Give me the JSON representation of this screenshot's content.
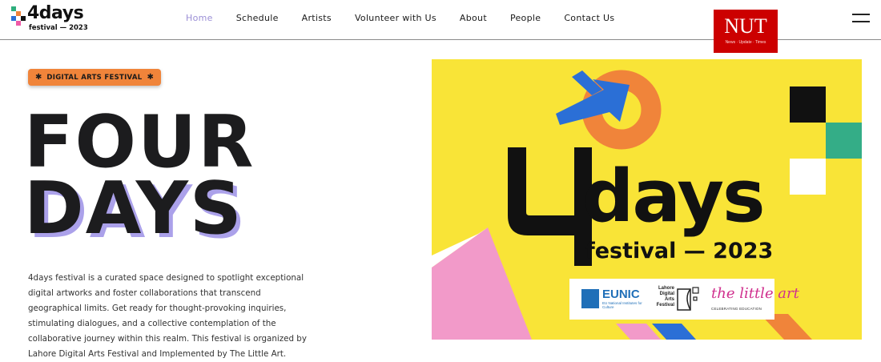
{
  "header": {
    "logo": {
      "word": "4days",
      "sub": "festival — 2023"
    },
    "nav": [
      {
        "label": "Home",
        "active": true
      },
      {
        "label": "Schedule",
        "active": false
      },
      {
        "label": "Artists",
        "active": false
      },
      {
        "label": "Volunteer with Us",
        "active": false
      },
      {
        "label": "About",
        "active": false
      },
      {
        "label": "People",
        "active": false
      },
      {
        "label": "Contact Us",
        "active": false
      }
    ],
    "menu_icon": "hamburger-menu-icon"
  },
  "nut_badge": {
    "title": "NUT",
    "sub": "News · Update · Times"
  },
  "hero": {
    "tag": "DIGITAL ARTS FESTIVAL",
    "tag_icon": "asterisk-icon",
    "line1": "FOUR",
    "line2": "DAYS",
    "description": "4days festival is a curated space designed to spotlight exceptional digital artworks and foster collaborations that transcend geographical limits. Get ready for thought-provoking inquiries, stimulating dialogues, and a collective contemplation of the collaborative journey within this realm. This festival is organized by Lahore Digital Arts Festival and Implemented by The Little Art."
  },
  "poster": {
    "word": "days",
    "sub": "festival — 2023",
    "partners": {
      "eunic": {
        "name": "EUNIC",
        "sub": "EU National Institutes for Culture"
      },
      "ldaf": {
        "text": "Lahore Digital Arts Festival"
      },
      "littleart": {
        "name": "the little art",
        "sub": "CELEBRATING EDUCATION"
      }
    }
  },
  "colors": {
    "accent_nav_active": "#9b8fd6",
    "tag_orange": "#f0843a",
    "hero_shadow": "#aba1ea",
    "poster_yellow": "#f9e437",
    "nut_red": "#cc0000"
  }
}
